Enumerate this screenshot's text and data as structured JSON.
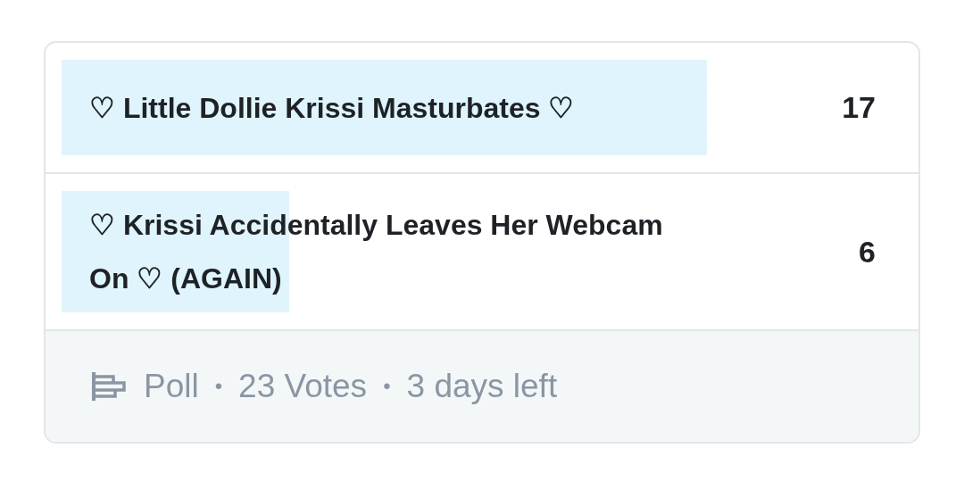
{
  "poll": {
    "options": [
      {
        "label": "♡ Little Dollie Krissi Masturbates ♡",
        "count": "17"
      },
      {
        "label": "♡ Krissi Accidentally Leaves Her Webcam On ♡ (AGAIN)",
        "count": "6"
      }
    ],
    "footer": {
      "items": [
        "Poll",
        "23 Votes",
        "3 days left"
      ],
      "separator": "•"
    }
  }
}
